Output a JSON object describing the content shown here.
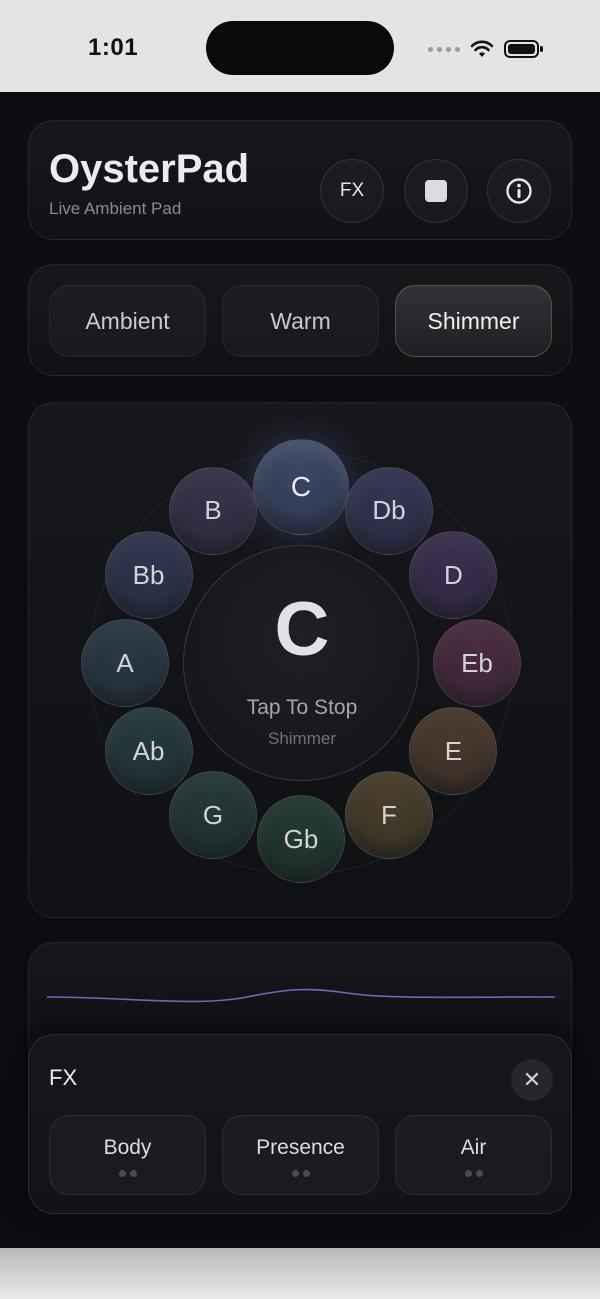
{
  "status_bar": {
    "time": "1:01"
  },
  "header": {
    "title": "OysterPad",
    "subtitle": "Live Ambient Pad",
    "fx_label": "FX"
  },
  "presets": [
    {
      "label": "Ambient",
      "selected": false
    },
    {
      "label": "Warm",
      "selected": false
    },
    {
      "label": "Shimmer",
      "selected": true
    }
  ],
  "wheel": {
    "notes": [
      {
        "label": "C",
        "color": "#3c4766",
        "active": true
      },
      {
        "label": "Db",
        "color": "#333553"
      },
      {
        "label": "D",
        "color": "#3b2f4f"
      },
      {
        "label": "Eb",
        "color": "#4a2d40"
      },
      {
        "label": "E",
        "color": "#4a3a2c"
      },
      {
        "label": "F",
        "color": "#4a3f2a"
      },
      {
        "label": "Gb",
        "color": "#223a33"
      },
      {
        "label": "G",
        "color": "#243a37"
      },
      {
        "label": "Ab",
        "color": "#243b40"
      },
      {
        "label": "A",
        "color": "#2a3a46"
      },
      {
        "label": "Bb",
        "color": "#2f3650"
      },
      {
        "label": "B",
        "color": "#37334b"
      }
    ],
    "center_note": "C",
    "center_action": "Tap To Stop",
    "center_preset": "Shimmer"
  },
  "fx_panel": {
    "title": "FX",
    "buttons": [
      {
        "label": "Body"
      },
      {
        "label": "Presence"
      },
      {
        "label": "Air"
      }
    ]
  },
  "colors": {
    "accent_wave": "#7a66b8",
    "background": "#0d0e12"
  }
}
